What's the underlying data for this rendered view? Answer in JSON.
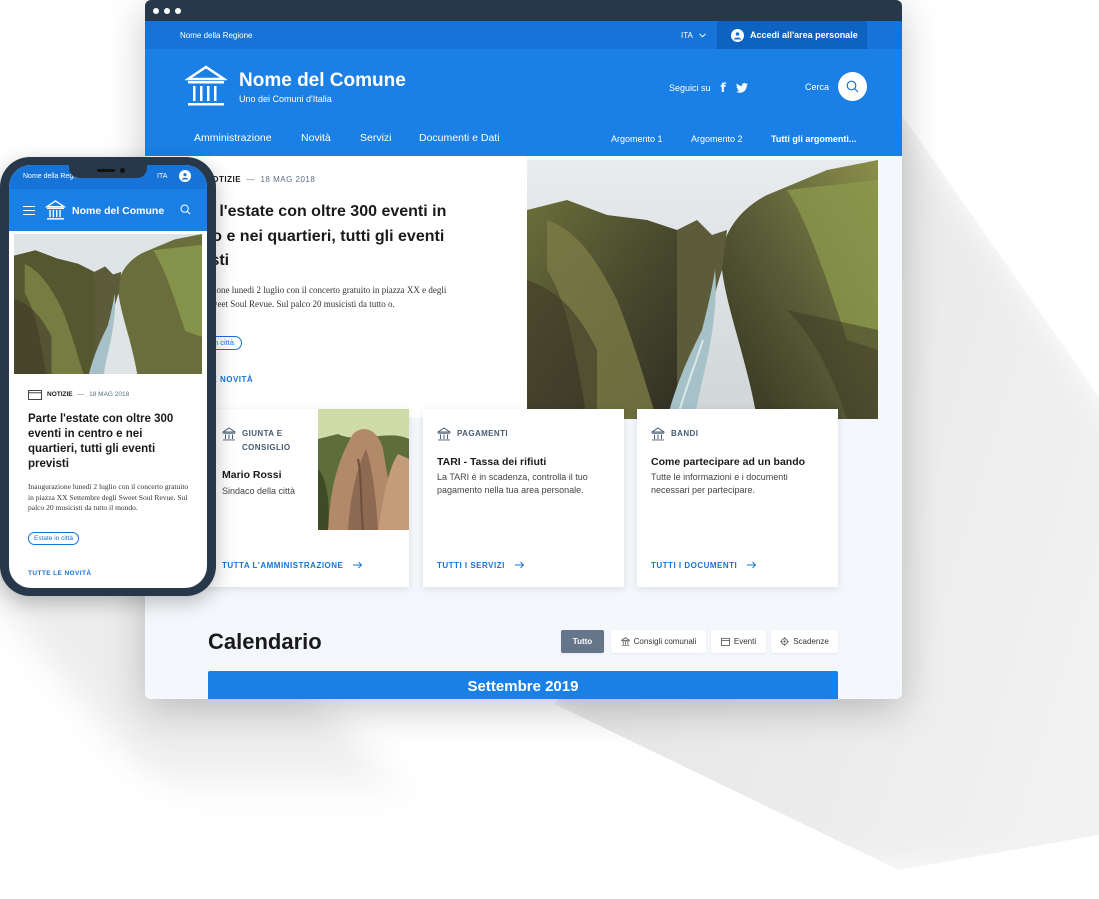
{
  "colors": {
    "primary": "#1a80e5",
    "primary_dark": "#1673d8",
    "login_bg": "#0e63c0",
    "window_bar": "#263849",
    "filter_active": "#65768a"
  },
  "slim_header": {
    "region": "Nome della Regione",
    "language": "ITA",
    "login_label": "Accedi all'area personale"
  },
  "brand": {
    "title": "Nome del Comune",
    "subtitle": "Uno dei Comuni d'Italia",
    "logo_icon": "town-hall-icon"
  },
  "social": {
    "label": "Seguici su",
    "facebook": "f",
    "icons": [
      "facebook-icon",
      "twitter-icon"
    ]
  },
  "search": {
    "label": "Cerca",
    "icon": "search-icon"
  },
  "nav": {
    "main": [
      "Amministrazione",
      "Novità",
      "Servizi",
      "Documenti e Dati"
    ],
    "topics": [
      "Argomento 1",
      "Argomento 2"
    ],
    "all_topics": "Tutti gli argomenti..."
  },
  "hero": {
    "category": "NOTIZIE",
    "separator": "—",
    "date": "18 MAG 2018",
    "title_visible": "e l'estate con oltre 300 eventi in ro e nei quartieri, tutti gli eventi isti",
    "text_visible": "azione lunedì 2 luglio con il concerto gratuito in piazza XX e degli Sweet Soul Revue. Sul palco 20 musicisti da tutto o.",
    "chip_visible": "n città",
    "all_link_visible": "LE NOVITÀ"
  },
  "cards": [
    {
      "category": "GIUNTA E CONSIGLIO",
      "title": "Mario Rossi",
      "text": "Sindaco della città",
      "link": "TUTTA L'AMMINISTRAZIONE"
    },
    {
      "category": "PAGAMENTI",
      "title": "TARI - Tassa dei rifiuti",
      "text": "La TARI è in scadenza, controlla il tuo pagamento nella tua area personale.",
      "link": "TUTTI I SERVIZI"
    },
    {
      "category": "BANDI",
      "title": "Come partecipare ad un bando",
      "text": "Tutte le informazioni e i documenti necessari per partecipare.",
      "link": "TUTTI I DOCUMENTI"
    }
  ],
  "calendar": {
    "title": "Calendario",
    "filters": [
      {
        "label": "Tutto",
        "active": true
      },
      {
        "label": "Consigli comunali",
        "icon": "town-hall-icon"
      },
      {
        "label": "Eventi",
        "icon": "calendar-icon"
      },
      {
        "label": "Scadenze",
        "icon": "gear-icon"
      }
    ],
    "month": "Settembre 2019"
  },
  "mobile": {
    "region": "Nome della Regione",
    "language": "ITA",
    "brand": "Nome del Comune",
    "category": "NOTIZIE",
    "separator": "—",
    "date": "18 MAG 2018",
    "title": "Parte l'estate con oltre 300 eventi in centro e nei quartieri, tutti gli eventi previsti",
    "text": "Inaugurazione lunedì 2 luglio con il concerto gratuito in piazza XX Settembre degli Sweet Soul Revue. Sul palco 20 musicisti da tutto il mondo.",
    "chip": "Estate in città",
    "all_link": "TUTTE LE NOVITÀ"
  }
}
